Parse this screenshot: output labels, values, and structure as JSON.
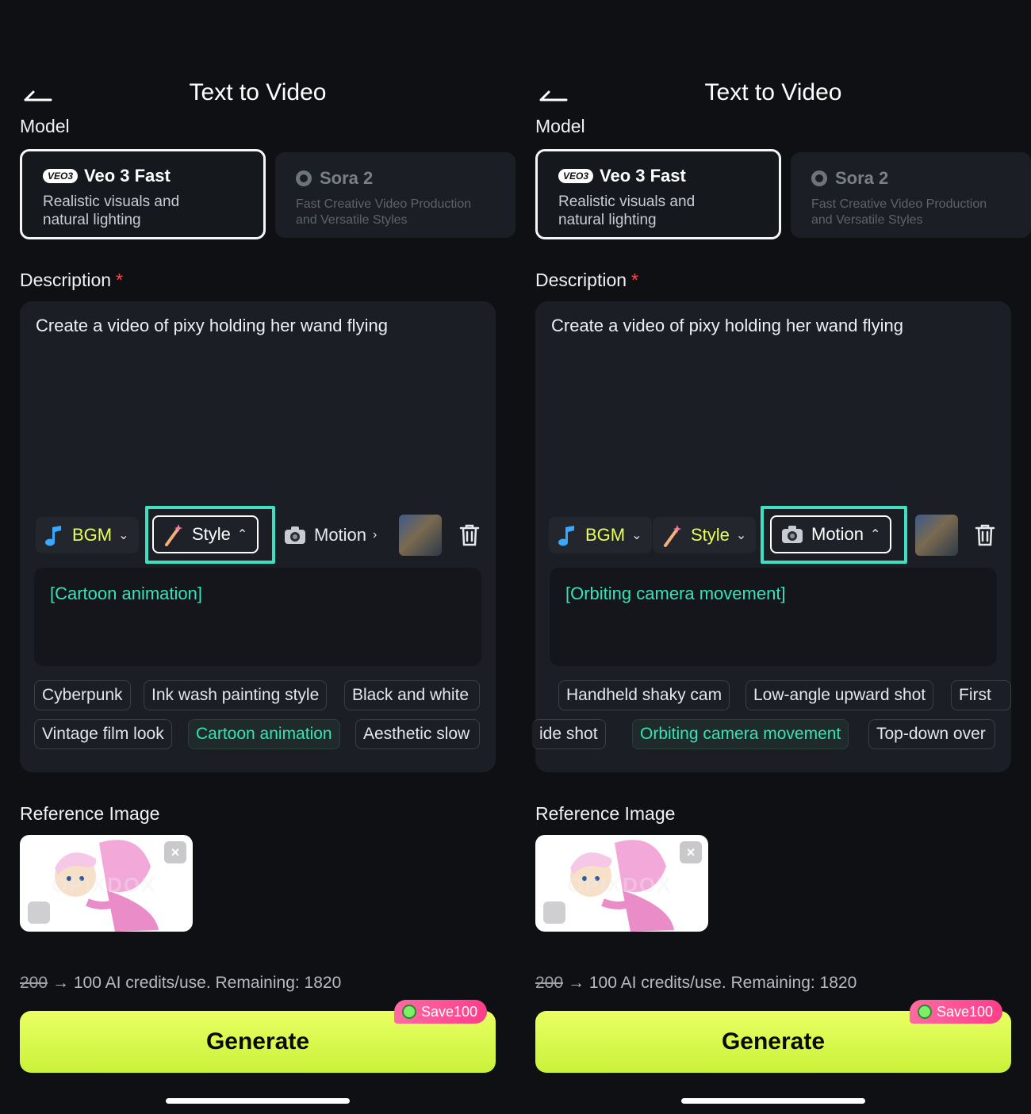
{
  "screens": [
    {
      "title": "Text to Video",
      "model_label": "Model",
      "models": [
        {
          "badge": "VEO3",
          "name": "Veo 3 Fast",
          "desc_line1": "Realistic visuals and",
          "desc_line2": "natural lighting"
        },
        {
          "name": "Sora 2",
          "desc_line1": "Fast Creative Video Production",
          "desc_line2": "and Versatile Styles"
        }
      ],
      "description_label": "Description",
      "required_mark": "*",
      "description_text": "Create a video of pixy holding her wand flying",
      "toolbar": {
        "bgm": "BGM",
        "style": "Style",
        "motion": "Motion"
      },
      "active_tool": "Style",
      "prompt_tag": "[Cartoon animation]",
      "chips_row1": [
        "Cyberpunk",
        "Ink wash painting style",
        "Black and white"
      ],
      "chips_row2": [
        "Vintage film look",
        "Cartoon animation",
        "Aesthetic slow"
      ],
      "selected_chip": "Cartoon animation",
      "reference_label": "Reference Image",
      "reference_watermark": "OPIXDOX",
      "credits_old": "200",
      "credits_text": "→ 100 AI credits/use. Remaining: 1820",
      "save_badge": "Save100",
      "generate_label": "Generate"
    },
    {
      "title": "Text to Video",
      "model_label": "Model",
      "models": [
        {
          "badge": "VEO3",
          "name": "Veo 3 Fast",
          "desc_line1": "Realistic visuals and",
          "desc_line2": "natural lighting"
        },
        {
          "name": "Sora 2",
          "desc_line1": "Fast Creative Video Production",
          "desc_line2": "and Versatile Styles"
        }
      ],
      "description_label": "Description",
      "required_mark": "*",
      "description_text": "Create a video of pixy holding her wand flying",
      "toolbar": {
        "bgm": "BGM",
        "style": "Style",
        "motion": "Motion"
      },
      "active_tool": "Motion",
      "prompt_tag": "[Orbiting camera movement]",
      "chips_row1": [
        "Handheld shaky cam",
        "Low-angle upward shot",
        "First"
      ],
      "chips_row2": [
        "ide shot",
        "Orbiting camera movement",
        "Top-down over"
      ],
      "selected_chip": "Orbiting camera movement",
      "reference_label": "Reference Image",
      "reference_watermark": "OPIXDOX",
      "credits_old": "200",
      "credits_text": "→ 100 AI credits/use. Remaining: 1820",
      "save_badge": "Save100",
      "generate_label": "Generate"
    }
  ],
  "colors": {
    "accent": "#e8ff5a",
    "highlight": "#3fe0c0",
    "selected_text": "#34e4b8",
    "background": "#0e1014",
    "required": "#ff4a4a"
  },
  "icons": [
    "back-arrow-icon",
    "veo-badge-icon",
    "sora-logo-icon",
    "music-note-icon",
    "magic-wand-icon",
    "camera-icon",
    "chevron-icon",
    "trash-icon",
    "close-icon",
    "edit-image-icon",
    "coin-icon"
  ]
}
